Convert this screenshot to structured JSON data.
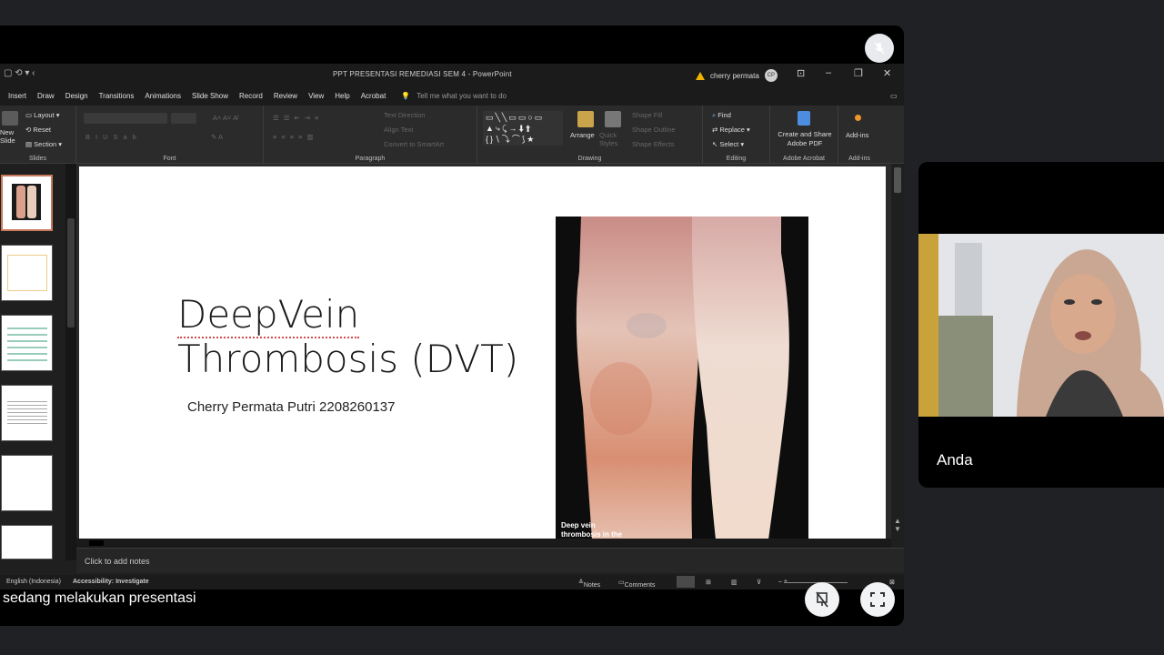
{
  "powerpoint": {
    "window_title": "PPT PRESENTASI REMEDIASI SEM 4  -  PowerPoint",
    "user_name": "cherry permata",
    "user_initials": "CP",
    "menu_tabs": [
      "Insert",
      "Draw",
      "Design",
      "Transitions",
      "Animations",
      "Slide Show",
      "Record",
      "Review",
      "View",
      "Help",
      "Acrobat"
    ],
    "tell_me_placeholder": "Tell me what you want to do",
    "ribbon": {
      "slides_group": {
        "new_slide": "New Slide",
        "layout": "Layout",
        "reset": "Reset",
        "section": "Section",
        "label": "Slides"
      },
      "font_label": "Font",
      "paragraph_group": {
        "text_direction": "Text Direction",
        "align_text": "Align Text",
        "convert_smartart": "Convert to SmartArt",
        "label": "Paragraph"
      },
      "drawing_group": {
        "arrange": "Arrange",
        "quick_styles": "Quick Styles",
        "shape_fill": "Shape Fill",
        "shape_outline": "Shape Outline",
        "shape_effects": "Shape Effects",
        "label": "Drawing"
      },
      "editing_group": {
        "find": "Find",
        "replace": "Replace",
        "select": "Select",
        "label": "Editing"
      },
      "acrobat_group": {
        "create_share": "Create and Share Adobe PDF",
        "label": "Adobe Acrobat"
      },
      "addins_group": {
        "addins": "Add-ins",
        "label": "Add-ins"
      }
    },
    "slide": {
      "title_line1": "DeepVein",
      "title_line2": "Thrombosis (DVT)",
      "author": "Cherry Permata Putri 2208260137",
      "image_caption": "Deep vein thrombosis in the"
    },
    "notes_placeholder": "Click to add notes",
    "status": {
      "language": "English (Indonesia)",
      "accessibility": "Accessibility: Investigate",
      "notes": "Notes",
      "comments": "Comments"
    }
  },
  "meeting": {
    "presenting_caption": "sedang melakukan presentasi",
    "self_tile_name": "Anda"
  },
  "colors": {
    "meeting_background": "#202124",
    "ribbon_background": "#2b2b2b",
    "selected_thumbnail_border": "#c8795c"
  },
  "icons": [
    "mic-off-icon",
    "present-stop-icon",
    "fullscreen-icon",
    "warning-icon",
    "lightbulb-icon",
    "find-icon",
    "replace-icon",
    "select-cursor-icon",
    "pdf-icon",
    "addins-icon"
  ]
}
